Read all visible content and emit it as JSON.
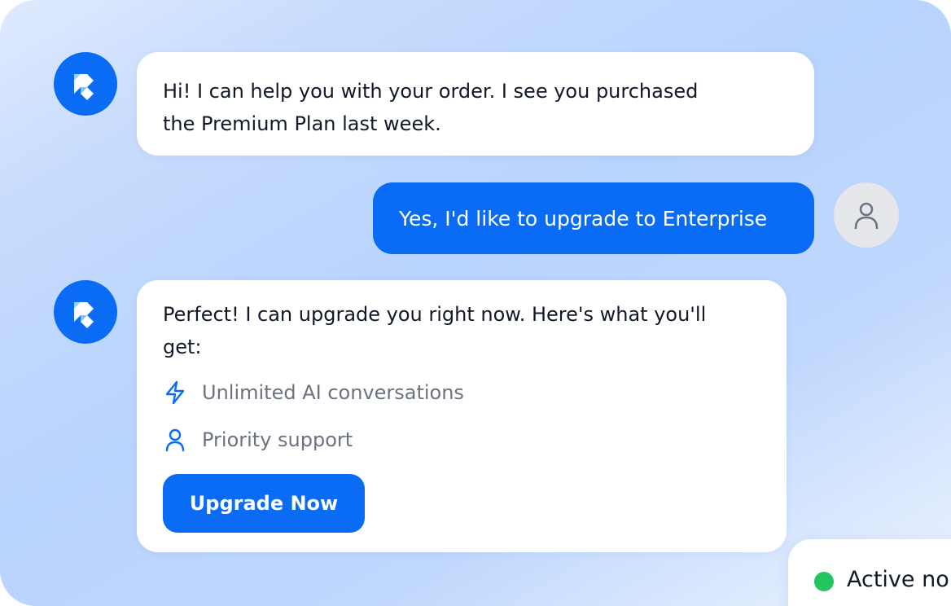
{
  "colors": {
    "accent": "#0a6cf5",
    "bubble_bg": "#ffffff",
    "user_avatar_bg": "#e5e7eb",
    "status_online": "#22c55e",
    "muted_text": "#6b7280"
  },
  "messages": [
    {
      "sender": "bot",
      "avatar_icon": "brand-logo-icon",
      "lines": [
        "Hi! I can help you with your order. I see you purchased",
        "the Premium Plan last week."
      ]
    },
    {
      "sender": "user",
      "avatar_icon": "user-icon",
      "text": "Yes, I'd like to upgrade to Enterprise"
    },
    {
      "sender": "bot",
      "avatar_icon": "brand-logo-icon",
      "lines": [
        "Perfect! I can upgrade you right now. Here's what you'll",
        "get:"
      ],
      "features": [
        {
          "icon": "lightning-bolt-icon",
          "label": "Unlimited AI conversations"
        },
        {
          "icon": "user-icon",
          "label": "Priority support"
        }
      ],
      "action_label": "Upgrade Now"
    }
  ],
  "status": {
    "label": "Active no",
    "indicator": "online-dot"
  }
}
